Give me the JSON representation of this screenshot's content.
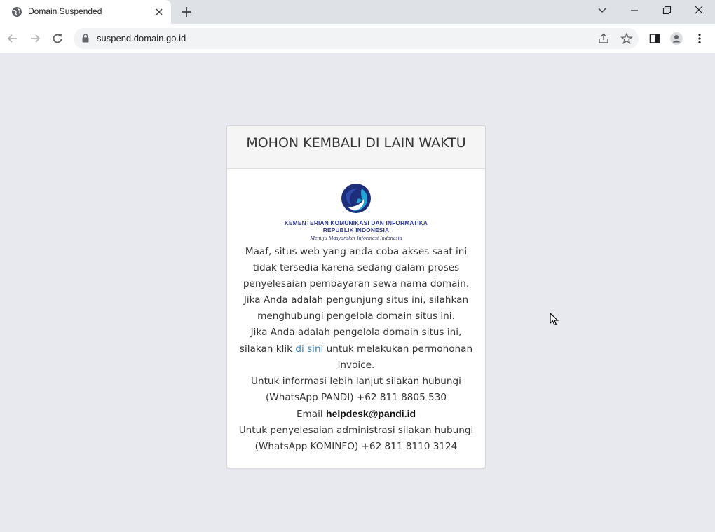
{
  "browser": {
    "tab_title": "Domain Suspended",
    "url": "suspend.domain.go.id",
    "icons": {
      "tab_favicon": "globe-icon",
      "tab_close": "close-icon",
      "new_tab": "plus-icon",
      "tab_search": "chevron-down-icon",
      "minimize": "minimize-icon",
      "restore": "restore-icon",
      "close_window": "close-icon",
      "back": "arrow-left-icon",
      "forward": "arrow-right-icon",
      "reload": "reload-icon",
      "lock": "lock-icon",
      "share": "share-icon",
      "bookmark": "star-icon",
      "side_panel": "side-panel-icon",
      "profile": "profile-icon",
      "menu": "kebab-menu-icon"
    }
  },
  "card": {
    "title": "MOHON KEMBALI DI LAIN WAKTU",
    "logo": {
      "line1": "KEMENTERIAN KOMUNIKASI DAN INFORMATIKA",
      "line2": "REPUBLIK INDONESIA",
      "tagline": "Menuju Masyarakat Informasi Indonesia"
    },
    "lines": {
      "l1": "Maaf, situs web yang anda coba akses saat ini",
      "l2": "tidak tersedia karena sedang dalam proses",
      "l3": "penyelesaian pembayaran sewa nama domain.",
      "l4": "Jika Anda adalah pengunjung situs ini, silahkan",
      "l5": "menghubungi pengelola domain situs ini.",
      "l6": "Jika Anda adalah pengelola domain situs ini,",
      "l7_before": "silakan klik ",
      "l7_link": "di sini",
      "l7_after": " untuk melakukan permohonan",
      "l8": "invoice.",
      "l9": "Untuk informasi lebih lanjut silakan hubungi",
      "l10": "(WhatsApp PANDI) +62 811 8805 530",
      "l11_label": "Email ",
      "l11_email": "helpdesk@pandi.id",
      "l12": "Untuk penyelesaian administrasi silakan hubungi",
      "l13": "(WhatsApp KOMINFO) +62 811 8110 3124"
    }
  },
  "colors": {
    "page_background": "#e8e9ee",
    "link": "#3b82c4",
    "logo_text": "#2f3b8f",
    "logo_dark_blue": "#1d2f7a",
    "logo_cyan": "#22a6d6"
  }
}
